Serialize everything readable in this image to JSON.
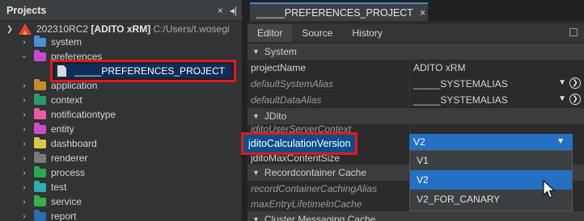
{
  "projects": {
    "title": "Projects",
    "close_icon": "×",
    "pin_icon": "◂|",
    "root": {
      "name": "202310RC2",
      "bracket": "[ADITO xRM]",
      "path": "C:/Users/t.wosegi"
    },
    "items": [
      {
        "label": "system",
        "color": "#4a8fd9",
        "expanded": false
      },
      {
        "label": "preferences",
        "color": "#c54bd0",
        "expanded": true
      },
      {
        "label": "application",
        "color": "#c98a2c",
        "expanded": false
      },
      {
        "label": "context",
        "color": "#2a9a6a",
        "expanded": false
      },
      {
        "label": "notificationtype",
        "color": "#ec5aa6",
        "expanded": false
      },
      {
        "label": "entity",
        "color": "#d04bd0",
        "expanded": false
      },
      {
        "label": "dashboard",
        "color": "#d8c84a",
        "expanded": false
      },
      {
        "label": "renderer",
        "color": "#7a7a7a",
        "expanded": false
      },
      {
        "label": "process",
        "color": "#2ea84d",
        "expanded": false
      },
      {
        "label": "test",
        "color": "#2eaeb0",
        "expanded": false
      },
      {
        "label": "service",
        "color": "#35b04a",
        "expanded": false
      },
      {
        "label": "report",
        "color": "#2a6bb3",
        "expanded": false
      }
    ],
    "selected_file": "_____PREFERENCES_PROJECT"
  },
  "editor": {
    "tab_title": "_____PREFERENCES_PROJECT",
    "tab_close": "×",
    "subtabs": [
      "Editor",
      "Source",
      "History"
    ],
    "groups": {
      "system": "System",
      "jdito": "JDito",
      "recordcontainer": "Recordcontainer Cache",
      "cluster": "Cluster Messaging Cache"
    },
    "properties": {
      "projectName": {
        "name": "projectName",
        "value": "ADITO xRM"
      },
      "defaultSystemAlias": {
        "name": "defaultSystemAlias",
        "value": "_____SYSTEMALIAS"
      },
      "defaultDataAlias": {
        "name": "defaultDataAlias",
        "value": "_____SYSTEMALIAS"
      },
      "jditoUserServerContext": {
        "name": "jditoUserServerContext"
      },
      "jditoCalculationVersion": {
        "name": "jditoCalculationVersion",
        "value": "V2"
      },
      "jditoMaxContentSize": {
        "name": "jditoMaxContentSize"
      },
      "recordContainerCachingAlias": {
        "name": "recordContainerCachingAlias"
      },
      "maxEntryLifetimeInCache": {
        "name": "maxEntryLifetimeInCache"
      }
    },
    "dropdown_options": [
      "V1",
      "V2",
      "V2_FOR_CANARY"
    ],
    "dropdown_selected": "V2"
  },
  "colors": {
    "highlight_red": "#e3171a",
    "selection_blue": "#2470c2"
  },
  "icons": [
    "close-icon",
    "pin-icon",
    "chevron-down-icon",
    "chevron-right-icon",
    "folder-icon",
    "file-icon",
    "adito-logo-icon",
    "dropdown-arrow-icon",
    "navigate-circle-icon",
    "mouse-cursor-icon",
    "maximize-icon"
  ]
}
